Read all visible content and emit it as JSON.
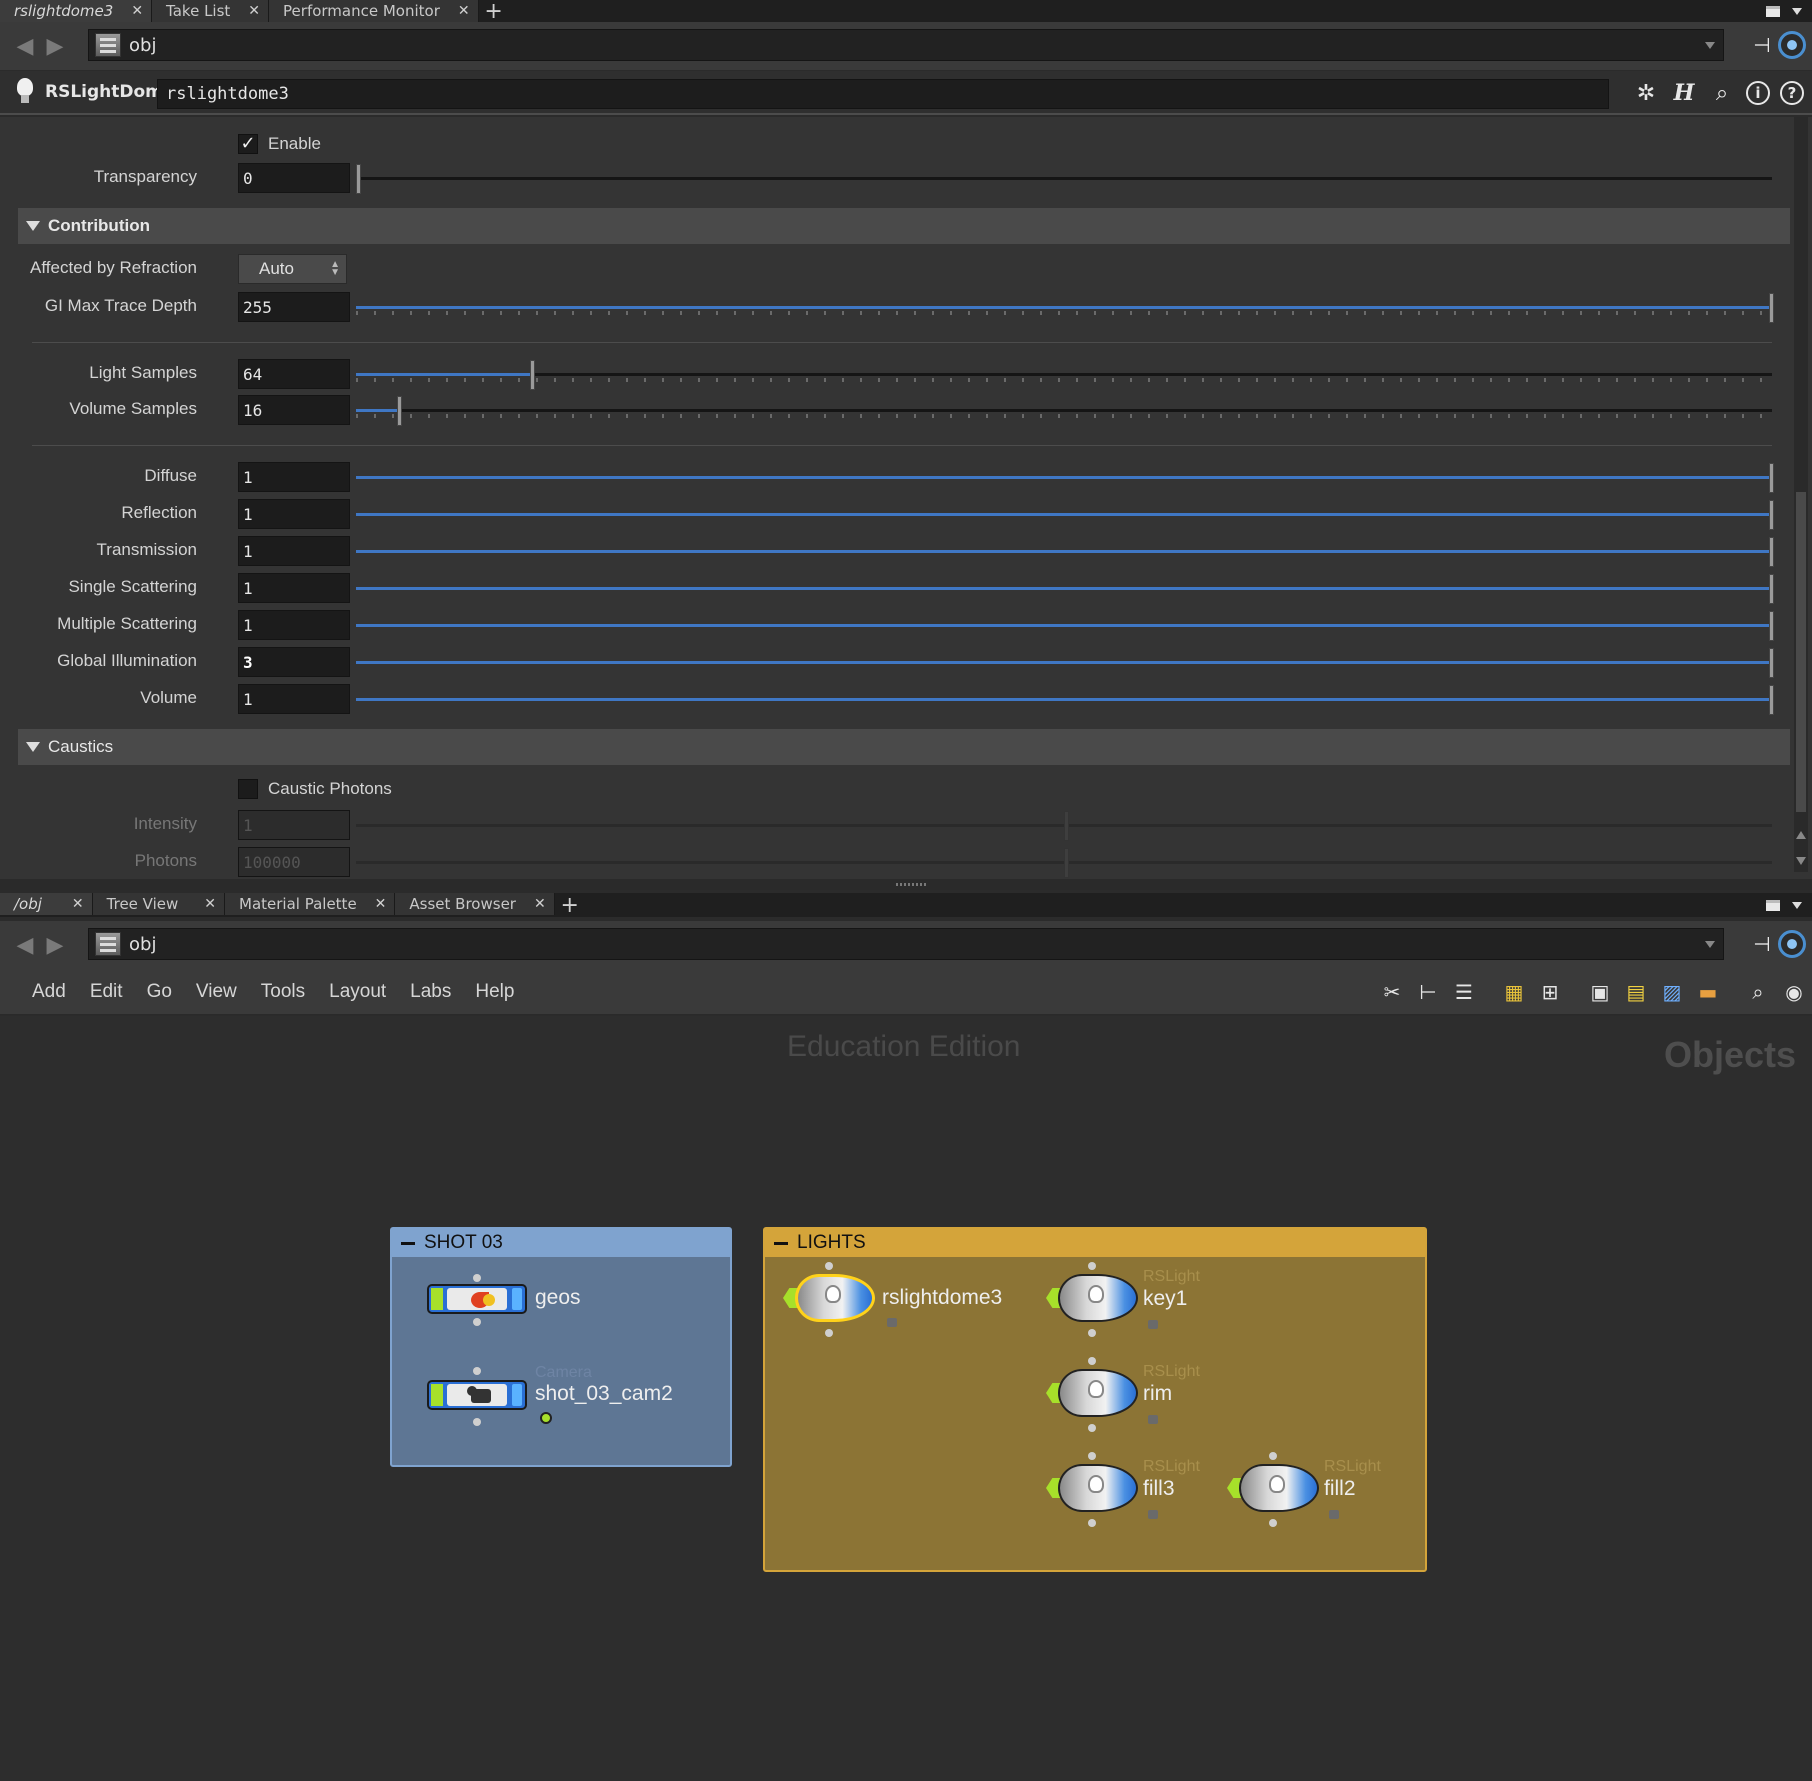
{
  "top_tabs": [
    {
      "label": "rslightdome3",
      "active": true
    },
    {
      "label": "Take List",
      "active": false
    },
    {
      "label": "Performance Monitor",
      "active": false
    }
  ],
  "top_path": "obj",
  "node_header": {
    "type": "RSLightDome",
    "name": "rslightdome3"
  },
  "params": {
    "enable_label": "Enable",
    "transparency": {
      "label": "Transparency",
      "value": "0",
      "fraction": 0
    },
    "contribution_title": "Contribution",
    "affected_by_refraction": {
      "label": "Affected by Refraction",
      "value": "Auto"
    },
    "gi_max_trace_depth": {
      "label": "GI Max Trace Depth",
      "value": "255",
      "fraction": 1
    },
    "light_samples": {
      "label": "Light Samples",
      "value": "64",
      "fraction": 0.125
    },
    "volume_samples": {
      "label": "Volume Samples",
      "value": "16",
      "fraction": 0.03
    },
    "multipliers": [
      {
        "label": "Diffuse",
        "value": "1",
        "bold": false
      },
      {
        "label": "Reflection",
        "value": "1",
        "bold": false
      },
      {
        "label": "Transmission",
        "value": "1",
        "bold": false
      },
      {
        "label": "Single Scattering",
        "value": "1",
        "bold": false
      },
      {
        "label": "Multiple Scattering",
        "value": "1",
        "bold": false
      },
      {
        "label": "Global Illumination",
        "value": "3",
        "bold": true
      },
      {
        "label": "Volume",
        "value": "1",
        "bold": false
      }
    ],
    "caustics_title": "Caustics",
    "caustic_photons_label": "Caustic Photons",
    "intensity": {
      "label": "Intensity",
      "value": "1"
    },
    "photons": {
      "label": "Photons",
      "value": "100000"
    }
  },
  "bottom_tabs": [
    {
      "label": "/obj",
      "active": true
    },
    {
      "label": "Tree View",
      "active": false
    },
    {
      "label": "Material Palette",
      "active": false
    },
    {
      "label": "Asset Browser",
      "active": false
    }
  ],
  "bottom_path": "obj",
  "menu": [
    "Add",
    "Edit",
    "Go",
    "View",
    "Tools",
    "Layout",
    "Labs",
    "Help"
  ],
  "network": {
    "watermark": "Education Edition",
    "context": "Objects",
    "shot_box": {
      "title": "SHOT 03",
      "color": "#7fa3cf",
      "body": "#5e7694"
    },
    "lights_box": {
      "title": "LIGHTS",
      "color": "#d4a43a",
      "body": "#8c7435"
    },
    "geos": "geos",
    "cam_type": "Camera",
    "cam": "shot_03_cam2",
    "dome": "rslightdome3",
    "light_type": "RSLight",
    "key": "key1",
    "rim": "rim",
    "fill3": "fill3",
    "fill2": "fill2"
  },
  "colors": {
    "accent": "#3f77c4",
    "flag": "#a7e02a",
    "select": "#ffd21a"
  }
}
